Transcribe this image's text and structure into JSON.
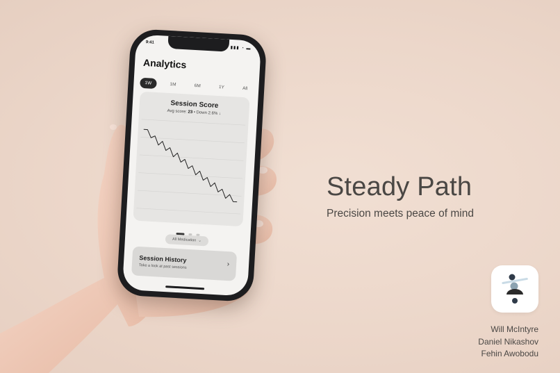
{
  "phone": {
    "status_time": "9:41",
    "status_icons": "▮▮▮ ◔ ▬",
    "app_title": "Analytics",
    "tabs": [
      {
        "label": "1W",
        "active": true
      },
      {
        "label": "1M",
        "active": false
      },
      {
        "label": "6M",
        "active": false
      },
      {
        "label": "1Y",
        "active": false
      },
      {
        "label": "All",
        "active": false
      }
    ],
    "card": {
      "title": "Session Score",
      "avg_label": "Avg score:",
      "avg_value": "23",
      "separator": "•",
      "trend": "Down 2.6%",
      "trend_icon": "↓"
    },
    "chart_data": {
      "type": "line",
      "x": [
        0,
        1,
        2,
        3,
        4,
        5,
        6,
        7,
        8,
        9,
        10,
        11,
        12,
        13,
        14,
        15,
        16,
        17,
        18,
        19,
        20,
        21,
        22,
        23,
        24,
        25
      ],
      "series": [
        {
          "values": [
            100,
            100,
            92,
            94,
            85,
            89,
            80,
            83,
            74,
            78,
            69,
            72,
            63,
            66,
            57,
            61,
            52,
            55,
            46,
            50,
            41,
            44,
            35,
            39,
            32,
            32
          ]
        }
      ],
      "ylim": [
        20,
        110
      ],
      "grid": true
    },
    "pager": {
      "count": 3,
      "active": 0
    },
    "filter": {
      "label": "All Medication",
      "icon": "chevron-down-icon"
    },
    "history": {
      "title": "Session History",
      "subtitle": "Take a look at past sessions",
      "icon": "chevron-right-icon"
    }
  },
  "brand": {
    "title": "Steady Path",
    "subtitle": "Precision meets peace of mind"
  },
  "credits": [
    "Will McIntyre",
    "Daniel Nikashov",
    "Fehin Awobodu"
  ],
  "colors": {
    "background": "#ecd7ca",
    "phone_frame": "#1d1d1f",
    "screen": "#f4f3f1",
    "card": "#e6e5e3",
    "text_dark": "#4a4744"
  }
}
